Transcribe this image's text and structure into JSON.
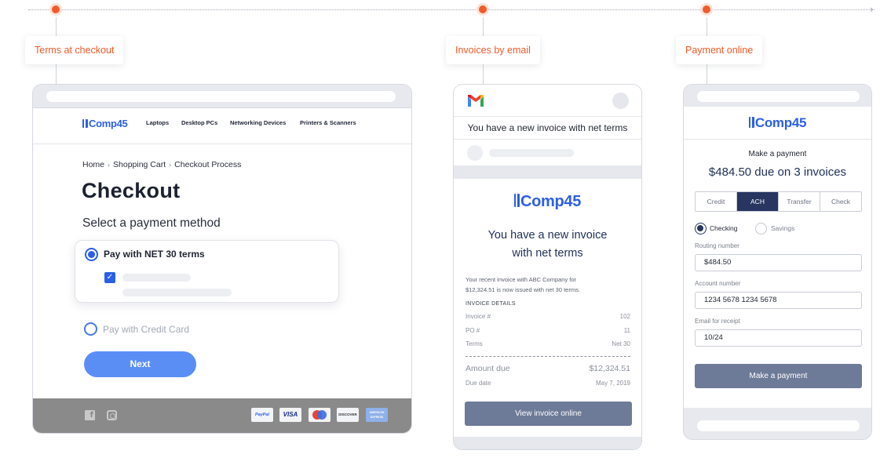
{
  "steps": [
    {
      "label": "Terms at checkout"
    },
    {
      "label": "Invoices by email"
    },
    {
      "label": "Payment online"
    }
  ],
  "checkout": {
    "logo": "Comp45",
    "nav": [
      "Laptops",
      "Desktop PCs",
      "Networking Devices",
      "Printers & Scanners"
    ],
    "breadcrumb": [
      "Home",
      "Shopping Cart",
      "Checkout Process"
    ],
    "title": "Checkout",
    "subtitle": "Select a payment method",
    "option_net": "Pay with NET 30 terms",
    "option_card": "Pay with Credit Card",
    "next_label": "Next",
    "footer": {
      "social_icons": [
        "facebook-icon",
        "instagram-icon"
      ],
      "card_logos": [
        "PayPal",
        "VISA",
        "mastercard",
        "DISCOVER",
        "AMERICAN EXPRESS"
      ]
    }
  },
  "email": {
    "subject": "You have a new invoice with net terms",
    "logo": "Comp45",
    "headline_line1": "You have a new invoice",
    "headline_line2": "with net terms",
    "body_line1": "Your recent invoice with ABC Company for",
    "body_line2": "$12,324.51 is now issued with net 30 terms.",
    "details_heading": "INVOICE DETAILS",
    "details": [
      {
        "label": "Invoice #",
        "value": "102"
      },
      {
        "label": "PO #",
        "value": "11"
      },
      {
        "label": "Terms",
        "value": "Net 30"
      }
    ],
    "amount_label": "Amount due",
    "amount_value": "$12,324.51",
    "due_label": "Due date",
    "due_value": "May 7, 2019",
    "view_button": "View invoice online"
  },
  "payment": {
    "logo": "Comp45",
    "subtitle": "Make a payment",
    "due": "$484.50 due on 3 invoices",
    "tabs": [
      {
        "label": "Credit"
      },
      {
        "label": "ACH"
      },
      {
        "label": "Transfer"
      },
      {
        "label": "Check"
      }
    ],
    "account_type_selected": "Checking",
    "account_type_other": "Savings",
    "fields": [
      {
        "label": "Routing number",
        "value": "$484.50"
      },
      {
        "label": "Account number",
        "value": "1234 5678 1234 5678"
      },
      {
        "label": "Email for receipt",
        "value": "10/24"
      }
    ],
    "pay_button": "Make a payment"
  },
  "colors": {
    "accent_orange": "#f25a2e",
    "brand_blue": "#2c5fe6",
    "navy": "#273560",
    "button_slate": "#6d7a98"
  }
}
